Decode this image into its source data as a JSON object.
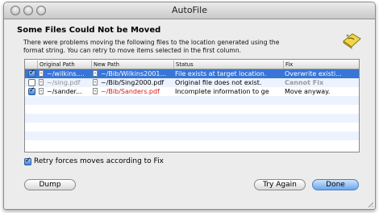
{
  "window": {
    "title": "AutoFile"
  },
  "dialog": {
    "heading": "Some Files Could Not be Moved",
    "description_line1": "There were problems moving the following files to the location generated using the",
    "description_line2": "format string. You can retry to move items selected in the first column."
  },
  "table": {
    "columns": [
      "",
      "Original Path",
      "New Path",
      "Status",
      "Fix"
    ],
    "rows": [
      {
        "checked": true,
        "selected": true,
        "original_path": "~/wilkins....",
        "new_path": "~/Bib/Wilkins2001...",
        "status": "File exists at target location.",
        "fix": "Overwrite existi..."
      },
      {
        "checked": false,
        "selected": false,
        "original_path": "~/sing.pdf",
        "new_path": "~/Bib/Sing2000.pdf",
        "status": "Original file does not exist.",
        "fix": "Cannot Fix"
      },
      {
        "checked": true,
        "selected": false,
        "original_path": "~/sander...",
        "new_path": "~/Bib/Sanders.pdf",
        "status": "Incomplete information to ge",
        "fix": "Move anyway."
      }
    ],
    "empty_rows": 6
  },
  "retry_checkbox": {
    "label": "Retry forces moves according to Fix",
    "checked": true
  },
  "buttons": {
    "dump": "Dump",
    "try_again": "Try Again",
    "done": "Done"
  },
  "colors": {
    "selection": "#3875d7",
    "alternate_row": "#edf3fe",
    "error_red": "#d21a1a",
    "done_button": "#6aa6ef"
  }
}
